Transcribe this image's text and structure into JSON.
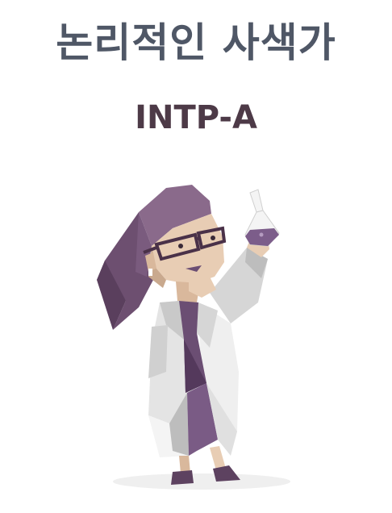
{
  "type_title": "논리적인 사색가",
  "type_code": "INTP-A",
  "illustration": {
    "icon": "scientist-with-flask-icon",
    "colors": {
      "hair": "#7a5b7e",
      "hair_dark": "#5d4260",
      "skin": "#e8cdb4",
      "skin_shadow": "#c9a98e",
      "glasses": "#4a3148",
      "coat_light": "#f1f1f1",
      "coat_mid": "#d6d6d6",
      "coat_shadow": "#a9a9a9",
      "shirt": "#6b4e73",
      "shirt_dark": "#54395c",
      "flask_liquid": "#7c5d8a",
      "shoes": "#5d4260",
      "floor_shadow": "#efefef"
    }
  }
}
